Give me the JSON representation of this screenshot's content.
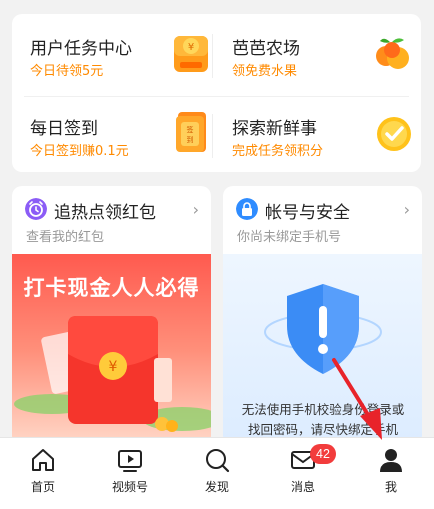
{
  "tasks": [
    {
      "title": "用户任务中心",
      "subtitle": "今日待领5元"
    },
    {
      "title": "芭芭农场",
      "subtitle": "领免费水果"
    },
    {
      "title": "每日签到",
      "subtitle": "今日签到赚0.1元"
    },
    {
      "title": "探索新鲜事",
      "subtitle": "完成任务领积分"
    }
  ],
  "promos": [
    {
      "title": "追热点领红包",
      "subtitle": "查看我的红包",
      "banner_text": "打卡现金人人必得"
    },
    {
      "title": "帐号与安全",
      "subtitle": "你尚未绑定手机号",
      "description": "无法使用手机校验身份登录或找回密码，请尽快绑定手机"
    }
  ],
  "tabbar": [
    {
      "label": "首页"
    },
    {
      "label": "视频号"
    },
    {
      "label": "发现"
    },
    {
      "label": "消息",
      "badge": "42"
    },
    {
      "label": "我"
    }
  ],
  "colors": {
    "accent": "#ff8a00",
    "badge": "#f23c3c",
    "arrow": "#e8232a"
  }
}
